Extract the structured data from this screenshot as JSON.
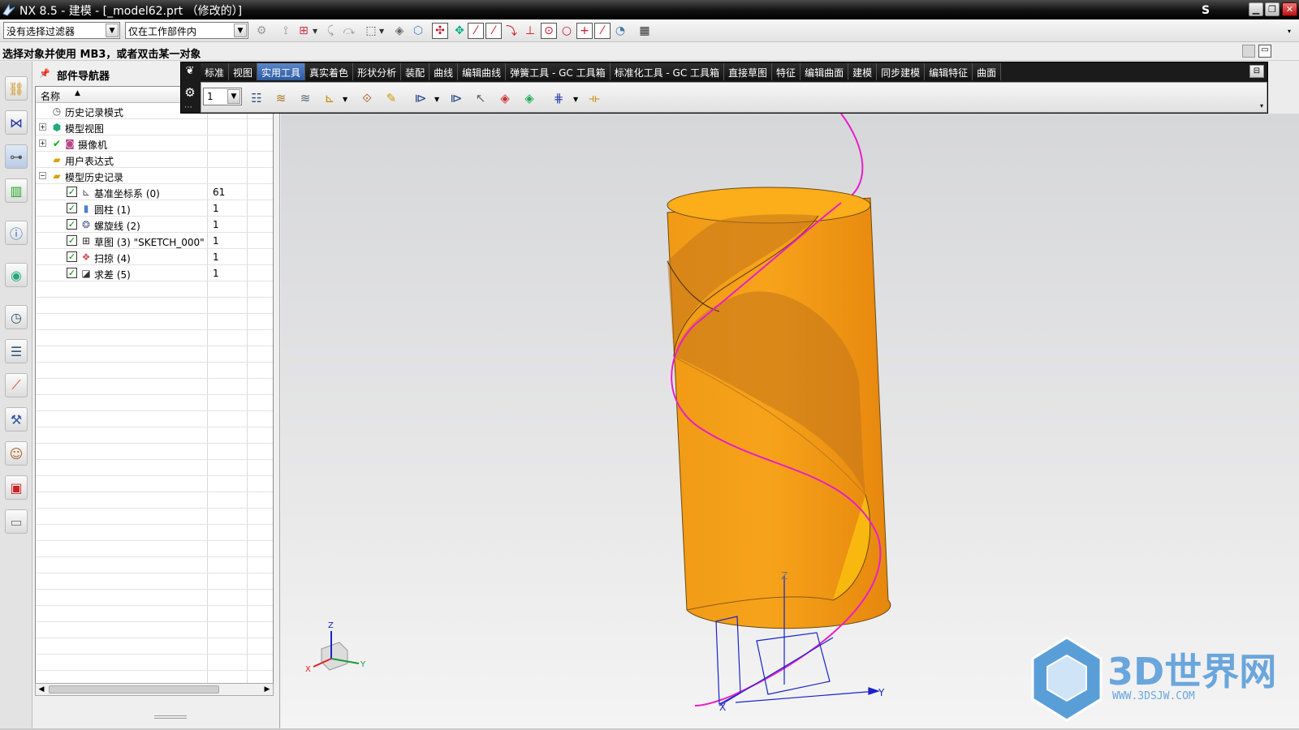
{
  "window": {
    "title": "NX 8.5 - 建模 - [_model62.prt （修改的）]",
    "corner_mark": "S",
    "minimize": "▁",
    "restore": "❐",
    "close": "✕"
  },
  "selection_bar": {
    "filter_value": "没有选择过滤器",
    "scope_value": "仅在工作部件内"
  },
  "prompt": "选择对象并使用 MB3，或者双击某一对象",
  "navigator": {
    "title": "部件导航器",
    "column_name": "名称",
    "rows": [
      {
        "label": "历史记录模式",
        "count": ""
      },
      {
        "label": "模型视图",
        "count": ""
      },
      {
        "label": "摄像机",
        "count": ""
      },
      {
        "label": "用户表达式",
        "count": ""
      },
      {
        "label": "模型历史记录",
        "count": ""
      },
      {
        "label": "基准坐标系 (0)",
        "count": "61"
      },
      {
        "label": "圆柱 (1)",
        "count": "1"
      },
      {
        "label": "螺旋线 (2)",
        "count": "1"
      },
      {
        "label": "草图 (3) \"SKETCH_000\"",
        "count": "1"
      },
      {
        "label": "扫掠 (4)",
        "count": "1"
      },
      {
        "label": "求差 (5)",
        "count": "1"
      }
    ]
  },
  "toolbar_tabs": [
    {
      "label": "标准",
      "active": false
    },
    {
      "label": "视图",
      "active": false
    },
    {
      "label": "实用工具",
      "active": true
    },
    {
      "label": "真实着色",
      "active": false
    },
    {
      "label": "形状分析",
      "active": false
    },
    {
      "label": "装配",
      "active": false
    },
    {
      "label": "曲线",
      "active": false
    },
    {
      "label": "编辑曲线",
      "active": false
    },
    {
      "label": "弹簧工具 - GC 工具箱",
      "active": false
    },
    {
      "label": "标准化工具 - GC 工具箱",
      "active": false
    },
    {
      "label": "直接草图",
      "active": false
    },
    {
      "label": "特征",
      "active": false
    },
    {
      "label": "编辑曲面",
      "active": false
    },
    {
      "label": "建模",
      "active": false
    },
    {
      "label": "同步建模",
      "active": false
    },
    {
      "label": "编辑特征",
      "active": false
    },
    {
      "label": "曲面",
      "active": false
    }
  ],
  "layer_dropdown": {
    "value": "1"
  },
  "triad": {
    "x": "X",
    "y": "Y",
    "z": "Z"
  },
  "watermark": {
    "text": "3D世界网",
    "url_text": "WWW.3DSJW.COM"
  },
  "colors": {
    "model": "#f39a12",
    "helix": "#e81ec8",
    "axes": "#1a23c8",
    "tab_active": "#2c5aa0"
  }
}
